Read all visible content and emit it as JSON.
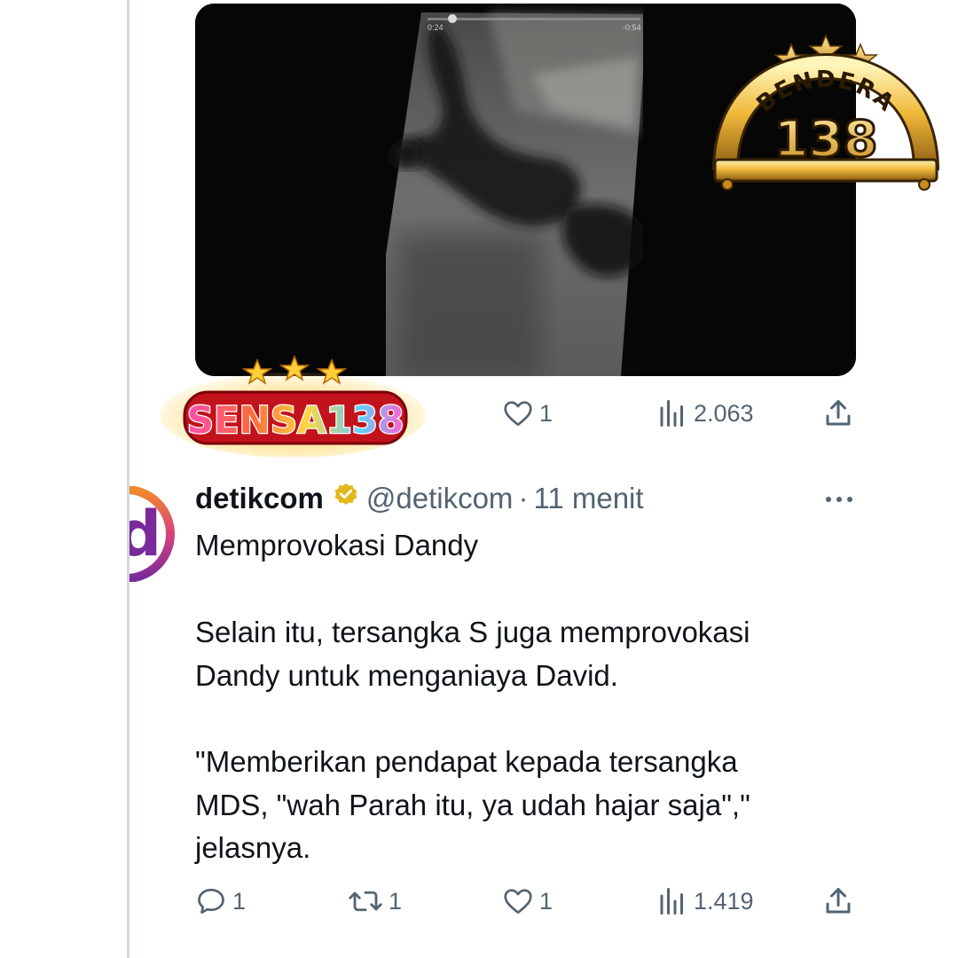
{
  "tweet1": {
    "likes": "1",
    "views": "2.063"
  },
  "tweet2": {
    "author_name": "detikcom",
    "handle": "@detikcom",
    "separator": "·",
    "time": "11 menit",
    "avatar_letter": "d",
    "text_lines": [
      "Memprovokasi Dandy",
      "Selain itu, tersangka S juga memprovokasi",
      "Dandy untuk menganiaya David.",
      "\"Memberikan pendapat kepada tersangka",
      "MDS, \"wah Parah itu, ya udah hajar saja\",\"",
      "jelasnya."
    ],
    "replies": "1",
    "retweets": "1",
    "likes": "1",
    "views": "1.419"
  },
  "video": {
    "elapsed": "0:24",
    "remaining": "-0:54"
  },
  "logos": {
    "sensa": "SENSA138",
    "bendera_word": "BENDERA",
    "bendera_number": "138"
  },
  "colors": {
    "text_primary": "#0f1419",
    "text_secondary": "#536471",
    "verified_gold": "#e2b719",
    "thread_line": "#cfd9de"
  },
  "icons": [
    "heart-icon",
    "views-icon",
    "share-icon",
    "reply-icon",
    "retweet-icon",
    "verified-badge-icon",
    "more-icon"
  ]
}
